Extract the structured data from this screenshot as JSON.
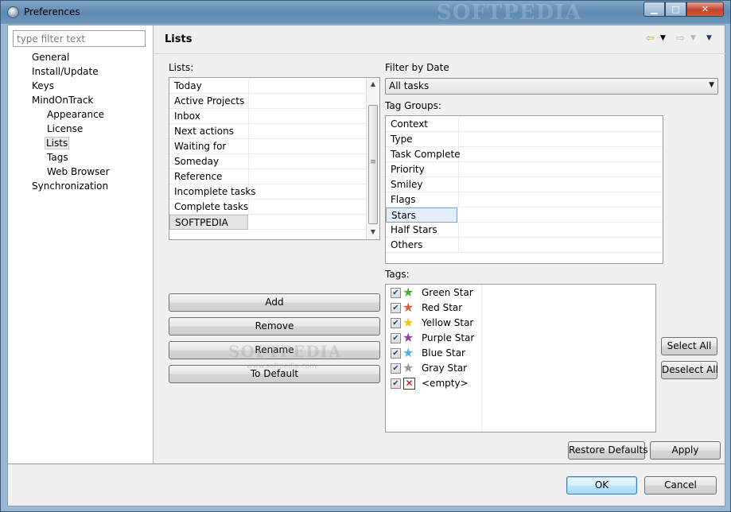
{
  "window": {
    "title": "Preferences",
    "title_watermark": "SOFTPEDIA"
  },
  "tree": {
    "filter_placeholder": "type filter text",
    "items": [
      {
        "label": "General",
        "level": 1
      },
      {
        "label": "Install/Update",
        "level": 1
      },
      {
        "label": "Keys",
        "level": 1
      },
      {
        "label": "MindOnTrack",
        "level": 1
      },
      {
        "label": "Appearance",
        "level": 2
      },
      {
        "label": "License",
        "level": 2
      },
      {
        "label": "Lists",
        "level": 2,
        "selected": true
      },
      {
        "label": "Tags",
        "level": 2
      },
      {
        "label": "Web Browser",
        "level": 2
      },
      {
        "label": "Synchronization",
        "level": 1
      }
    ]
  },
  "panel": {
    "title": "Lists",
    "lists_label": "Lists:",
    "lists": [
      "Today",
      "Active Projects",
      "Inbox",
      "Next actions",
      "Waiting for",
      "Someday",
      "Reference",
      "Incomplete tasks",
      "Complete tasks",
      "SOFTPEDIA"
    ],
    "lists_selected": "SOFTPEDIA",
    "filter_label": "Filter by Date",
    "filter_value": "All tasks",
    "tag_groups_label": "Tag Groups:",
    "tag_groups": [
      "Context",
      "Type",
      "Task Complete",
      "Priority",
      "Smiley",
      "Flags",
      "Stars",
      "Half Stars",
      "Others"
    ],
    "tag_groups_selected": "Stars",
    "tags_label": "Tags:",
    "tags": [
      {
        "label": "Green Star",
        "checked": true,
        "color": "#4caf32",
        "icon": "star-icon"
      },
      {
        "label": "Red Star",
        "checked": true,
        "color": "#e05a4a",
        "icon": "star-icon"
      },
      {
        "label": "Yellow Star",
        "checked": true,
        "color": "#f2c515",
        "icon": "star-icon"
      },
      {
        "label": "Purple Star",
        "checked": true,
        "color": "#9b3fa0",
        "icon": "star-icon"
      },
      {
        "label": "Blue Star",
        "checked": true,
        "color": "#4fb3e8",
        "icon": "star-icon"
      },
      {
        "label": "Gray Star",
        "checked": true,
        "color": "#9a9a9a",
        "icon": "star-icon"
      },
      {
        "label": "<empty>",
        "checked": true,
        "color": "#c00000",
        "icon": "empty-x-icon"
      }
    ],
    "buttons": {
      "add": "Add",
      "remove": "Remove",
      "rename": "Rename",
      "to_default": "To Default",
      "select_all": "Select All",
      "deselect_all": "Deselect All",
      "restore_defaults": "Restore Defaults",
      "apply": "Apply"
    },
    "watermark": "SOFTPEDIA",
    "watermark_url": "www.softpedia.com"
  },
  "dialog_buttons": {
    "ok": "OK",
    "cancel": "Cancel"
  }
}
